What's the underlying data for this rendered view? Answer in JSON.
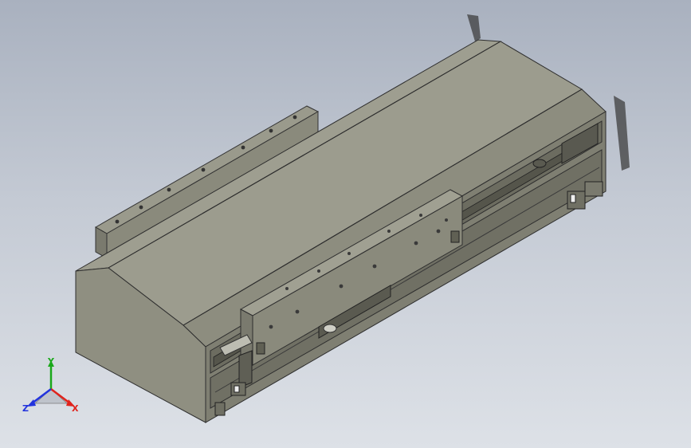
{
  "viewport": {
    "background_top": "#a9b1bf",
    "background_bottom": "#dde1e7"
  },
  "model": {
    "description_icon": "linear-actuator-3d-model",
    "body_color": "#8e8e80",
    "top_color": "#9c9c8e",
    "dark_color": "#5c5c52"
  },
  "triad": {
    "x_label": "X",
    "y_label": "Y",
    "z_label": "Z",
    "x_color": "#e0231c",
    "y_color": "#1aa81a",
    "z_color": "#2233dd"
  }
}
